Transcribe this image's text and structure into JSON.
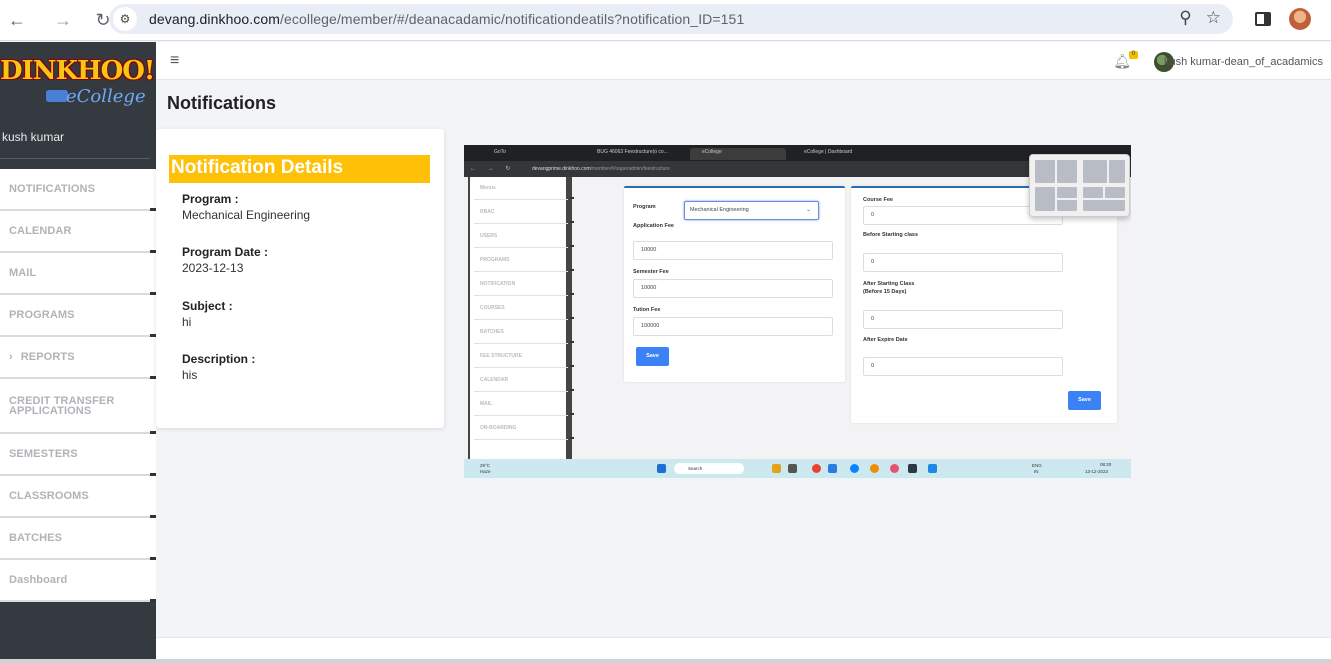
{
  "browser": {
    "url_host": "devang.dinkhoo.com",
    "url_path": "/ecollege/member/#/deanacadamic/notificationdeatils?notification_ID=151"
  },
  "header": {
    "user_name": "kush kumar-dean_of_acadamics",
    "notification_count": "0"
  },
  "sidebar": {
    "logo_main": "DINKHOO!",
    "logo_sub": "eCollege",
    "user": "kush kumar",
    "items": [
      {
        "label": "NOTIFICATIONS"
      },
      {
        "label": "CALENDAR"
      },
      {
        "label": "MAIL"
      },
      {
        "label": "PROGRAMS"
      },
      {
        "label": "REPORTS"
      },
      {
        "label": "CREDIT TRANSFER APPLICATIONS"
      },
      {
        "label": "SEMESTERS"
      },
      {
        "label": "CLASSROOMS"
      },
      {
        "label": "BATCHES"
      },
      {
        "label": "Dashboard"
      }
    ]
  },
  "main": {
    "page_title": "Notifications",
    "card_title": "Notification Details",
    "program_label": "Program :",
    "program_value": "Mechanical Engineering",
    "date_label": "Program Date :",
    "date_value": "2023-12-13",
    "subject_label": "Subject :",
    "subject_value": "hi",
    "description_label": "Description :",
    "description_value": "his"
  },
  "attachment": {
    "tabs": [
      "GoTo",
      "BUG 46063 Feestructure(o co...",
      "eCollege",
      "eCollege | Dashboard"
    ],
    "url_host": "devangprime.dinkhoo.com",
    "url_path": "/member/#/superadmin/feestructure",
    "menu": [
      "Menus",
      "RBAC",
      "USERS",
      "PROGRAMS",
      "NOTIFICATION",
      "COURSES",
      "BATCHES",
      "FEE STRUCTURE",
      "CALENDAR",
      "MAIL",
      "ON-BOARDING"
    ],
    "left_form": {
      "program_label": "Program",
      "program_value": "Mechanical Engineering",
      "application_fee_label": "Application Fee",
      "application_fee": "10000",
      "semester_fee_label": "Semester Fee",
      "semester_fee": "10000",
      "tuition_fee_label": "Tution Fee",
      "tuition_fee": "100000",
      "save": "Save"
    },
    "right_form": {
      "course_fee_label": "Course Fee",
      "course_fee": "0",
      "before_label": "Before Starting class",
      "before_value": "0",
      "after_label": "After Starting Class (Before 15 Days)",
      "after_value": "0",
      "expire_label": "After Expire Date",
      "expire_value": "0",
      "save": "Save"
    },
    "taskbar": {
      "weather_temp": "29°C",
      "weather_desc": "Haze",
      "search": "Search",
      "lang": "ENG",
      "region": "IN",
      "time": "08:20",
      "date": "13-12-2023"
    }
  }
}
